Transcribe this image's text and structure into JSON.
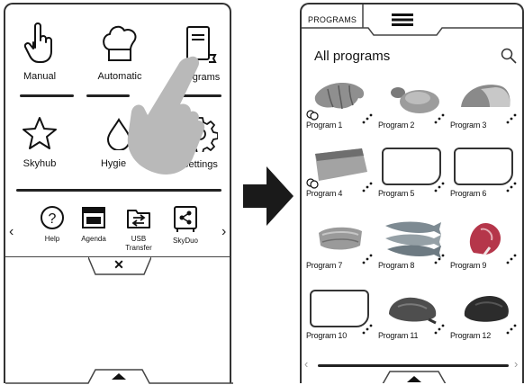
{
  "left_panel": {
    "tiles": [
      {
        "label": "Manual",
        "icon": "hand-pointer-icon"
      },
      {
        "label": "Automatic",
        "icon": "chef-hat-icon"
      },
      {
        "label": "Programs",
        "visible_label": "grams",
        "icon": "book-icon"
      },
      {
        "label": "Skyhub",
        "icon": "star-icon"
      },
      {
        "label": "Hygiene",
        "visible_label": "Hygie",
        "icon": "drop-icon"
      },
      {
        "label": "Settings",
        "icon": "gear-icon"
      }
    ],
    "tools": [
      {
        "label": "Help",
        "icon": "help-icon"
      },
      {
        "label": "Agenda",
        "icon": "agenda-icon"
      },
      {
        "label": "USB\nTransfer",
        "icon": "usb-transfer-icon"
      },
      {
        "label": "SkyDuo",
        "icon": "skyduo-icon"
      }
    ],
    "close_symbol": "✕"
  },
  "right_panel": {
    "header_label": "PROGRAMS",
    "title": "All programs",
    "programs": [
      {
        "label": "Program 1",
        "thumb": "croissant",
        "multi": true
      },
      {
        "label": "Program 2",
        "thumb": "bread-roll",
        "multi": false
      },
      {
        "label": "Program 3",
        "thumb": "bread-loaf",
        "multi": false
      },
      {
        "label": "Program 4",
        "thumb": "bread-slab",
        "multi": true
      },
      {
        "label": "Program 5",
        "thumb": "empty",
        "multi": false
      },
      {
        "label": "Program 6",
        "thumb": "empty",
        "multi": false
      },
      {
        "label": "Program 7",
        "thumb": "fish-fillet",
        "multi": false
      },
      {
        "label": "Program 8",
        "thumb": "fish",
        "multi": false
      },
      {
        "label": "Program 9",
        "thumb": "steak",
        "multi": false
      },
      {
        "label": "Program 10",
        "thumb": "empty",
        "multi": false
      },
      {
        "label": "Program 11",
        "thumb": "roast",
        "multi": false
      },
      {
        "label": "Program 12",
        "thumb": "roast-dark",
        "multi": false
      }
    ]
  }
}
